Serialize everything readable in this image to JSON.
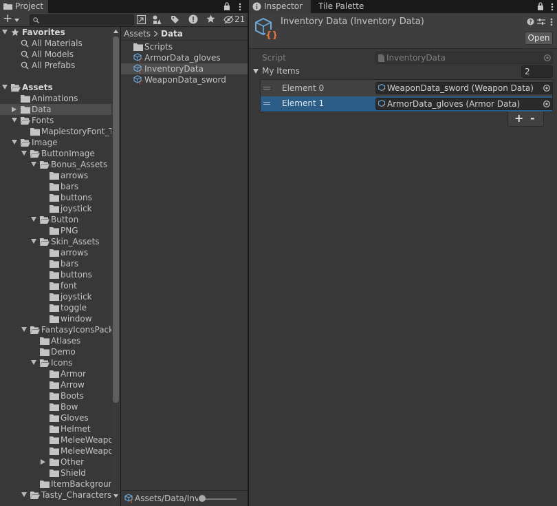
{
  "project_tab": {
    "label": "Project"
  },
  "inspector_tabs": [
    {
      "label": "Inspector"
    },
    {
      "label": "Tile Palette"
    }
  ],
  "project_toolbar": {
    "add_label": "+",
    "hidden_count": "21"
  },
  "tree": [
    {
      "label": "Favorites",
      "depth": 0,
      "fold": "open",
      "icon": "star-icon",
      "bold": true
    },
    {
      "label": "All Materials",
      "depth": 1,
      "fold": "none",
      "icon": "search-icon"
    },
    {
      "label": "All Models",
      "depth": 1,
      "fold": "none",
      "icon": "search-icon"
    },
    {
      "label": "All Prefabs",
      "depth": 1,
      "fold": "none",
      "icon": "search-icon"
    },
    {
      "label": "",
      "depth": 0,
      "fold": "none",
      "icon": ""
    },
    {
      "label": "Assets",
      "depth": 0,
      "fold": "open",
      "icon": "folder-open-icon",
      "bold": true
    },
    {
      "label": "Animations",
      "depth": 1,
      "fold": "none",
      "icon": "folder-icon"
    },
    {
      "label": "Data",
      "depth": 1,
      "fold": "closed",
      "icon": "folder-icon",
      "selected": true
    },
    {
      "label": "Fonts",
      "depth": 1,
      "fold": "open",
      "icon": "folder-open-icon"
    },
    {
      "label": "MaplestoryFont_T",
      "depth": 2,
      "fold": "none",
      "icon": "folder-icon"
    },
    {
      "label": "Image",
      "depth": 1,
      "fold": "open",
      "icon": "folder-open-icon"
    },
    {
      "label": "ButtonImage",
      "depth": 2,
      "fold": "open",
      "icon": "folder-open-icon"
    },
    {
      "label": "Bonus_Assets",
      "depth": 3,
      "fold": "open",
      "icon": "folder-open-icon"
    },
    {
      "label": "arrows",
      "depth": 4,
      "fold": "none",
      "icon": "folder-icon"
    },
    {
      "label": "bars",
      "depth": 4,
      "fold": "none",
      "icon": "folder-icon"
    },
    {
      "label": "buttons",
      "depth": 4,
      "fold": "none",
      "icon": "folder-icon"
    },
    {
      "label": "joystick",
      "depth": 4,
      "fold": "none",
      "icon": "folder-icon"
    },
    {
      "label": "Button",
      "depth": 3,
      "fold": "open",
      "icon": "folder-open-icon"
    },
    {
      "label": "PNG",
      "depth": 4,
      "fold": "none",
      "icon": "folder-icon"
    },
    {
      "label": "Skin_Assets",
      "depth": 3,
      "fold": "open",
      "icon": "folder-open-icon"
    },
    {
      "label": "arrows",
      "depth": 4,
      "fold": "none",
      "icon": "folder-icon"
    },
    {
      "label": "bars",
      "depth": 4,
      "fold": "none",
      "icon": "folder-icon"
    },
    {
      "label": "buttons",
      "depth": 4,
      "fold": "none",
      "icon": "folder-icon"
    },
    {
      "label": "font",
      "depth": 4,
      "fold": "none",
      "icon": "folder-icon"
    },
    {
      "label": "joystick",
      "depth": 4,
      "fold": "none",
      "icon": "folder-icon"
    },
    {
      "label": "toggle",
      "depth": 4,
      "fold": "none",
      "icon": "folder-icon"
    },
    {
      "label": "window",
      "depth": 4,
      "fold": "none",
      "icon": "folder-icon"
    },
    {
      "label": "FantasyIconsPack",
      "depth": 2,
      "fold": "open",
      "icon": "folder-open-icon"
    },
    {
      "label": "Atlases",
      "depth": 3,
      "fold": "none",
      "icon": "folder-icon"
    },
    {
      "label": "Demo",
      "depth": 3,
      "fold": "none",
      "icon": "folder-icon"
    },
    {
      "label": "Icons",
      "depth": 3,
      "fold": "open",
      "icon": "folder-open-icon"
    },
    {
      "label": "Armor",
      "depth": 4,
      "fold": "none",
      "icon": "folder-icon"
    },
    {
      "label": "Arrow",
      "depth": 4,
      "fold": "none",
      "icon": "folder-icon"
    },
    {
      "label": "Boots",
      "depth": 4,
      "fold": "none",
      "icon": "folder-icon"
    },
    {
      "label": "Bow",
      "depth": 4,
      "fold": "none",
      "icon": "folder-icon"
    },
    {
      "label": "Gloves",
      "depth": 4,
      "fold": "none",
      "icon": "folder-icon"
    },
    {
      "label": "Helmet",
      "depth": 4,
      "fold": "none",
      "icon": "folder-icon"
    },
    {
      "label": "MeleeWeapo",
      "depth": 4,
      "fold": "none",
      "icon": "folder-icon"
    },
    {
      "label": "MeleeWeapo",
      "depth": 4,
      "fold": "none",
      "icon": "folder-icon"
    },
    {
      "label": "Other",
      "depth": 4,
      "fold": "closed",
      "icon": "folder-icon"
    },
    {
      "label": "Shield",
      "depth": 4,
      "fold": "none",
      "icon": "folder-icon"
    },
    {
      "label": "ItemBackground",
      "depth": 3,
      "fold": "none",
      "icon": "folder-icon"
    },
    {
      "label": "Tasty_Characters",
      "depth": 2,
      "fold": "open",
      "icon": "folder-open-icon"
    }
  ],
  "breadcrumb": {
    "root": "Assets",
    "current": "Data"
  },
  "files": [
    {
      "label": "Scripts",
      "icon": "folder-icon"
    },
    {
      "label": "ArmorData_gloves",
      "icon": "scriptable-object-icon"
    },
    {
      "label": "InventoryData",
      "icon": "scriptable-object-icon",
      "selected": true
    },
    {
      "label": "WeaponData_sword",
      "icon": "scriptable-object-icon"
    }
  ],
  "footer_path": "Assets/Data/Inve",
  "inspector": {
    "title": "Inventory Data (Inventory Data)",
    "open_label": "Open",
    "script_label": "Script",
    "script_value": "InventoryData",
    "list_label": "My Items",
    "list_size": "2",
    "elements": [
      {
        "label": "Element 0",
        "value": "WeaponData_sword (Weapon Data)"
      },
      {
        "label": "Element 1",
        "value": "ArmorData_gloves (Armor Data)",
        "selected": true
      }
    ],
    "add_label": "+",
    "remove_label": "-"
  },
  "colors": {
    "selection": "#2c5d87",
    "tree_selection": "#4d4d4d",
    "accent_icon": "#e8743b",
    "cube_icon": "#6fa8dc"
  }
}
